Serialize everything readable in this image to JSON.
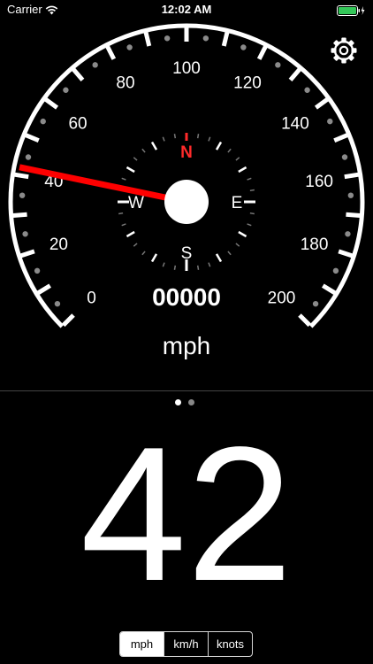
{
  "status_bar": {
    "carrier": "Carrier",
    "time": "12:02 AM"
  },
  "gauge": {
    "scale_labels": [
      "0",
      "20",
      "40",
      "60",
      "80",
      "100",
      "120",
      "140",
      "160",
      "180",
      "200"
    ],
    "scale_max": 200,
    "needle_value": 42,
    "needle_color": "#ff0000",
    "compass": {
      "north": "N",
      "east": "E",
      "south": "S",
      "west": "W",
      "north_color": "#ff2a2a"
    }
  },
  "odometer": "00000",
  "unit_label": "mph",
  "page_indicator": {
    "pages": 2,
    "current": 0
  },
  "speed": "42",
  "unit_selector": {
    "options": [
      {
        "label": "mph",
        "selected": true
      },
      {
        "label": "km/h",
        "selected": false
      },
      {
        "label": "knots",
        "selected": false
      }
    ]
  }
}
